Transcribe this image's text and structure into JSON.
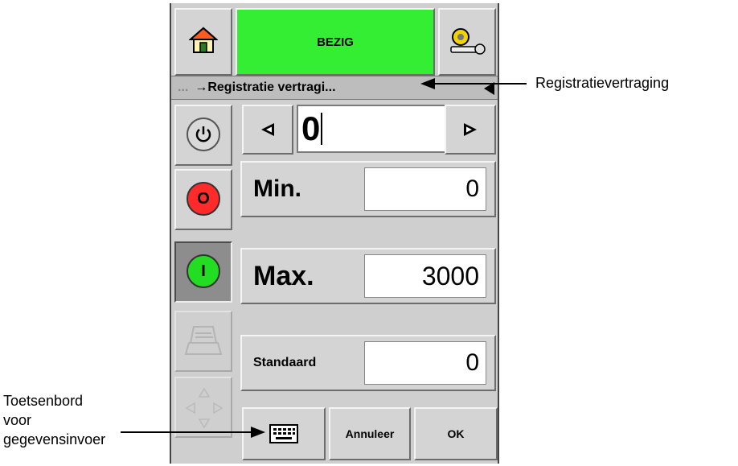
{
  "header": {
    "status_label": "BEZIG",
    "status_color": "#33ee33",
    "home_icon": "home-icon",
    "service_icon": "service-wrench-icon"
  },
  "breadcrumb": {
    "ellipsis": "...",
    "text": "→Registratie vertragi..."
  },
  "sidebar": {
    "items": [
      {
        "icon": "power-icon",
        "label": ""
      },
      {
        "icon": "stop-icon",
        "label": "O",
        "color": "#ff2a2a"
      },
      {
        "icon": "start-icon",
        "label": "I",
        "color": "#22dd22"
      },
      {
        "icon": "printer-icon",
        "label": ""
      },
      {
        "icon": "navigation-arrows-icon",
        "label": ""
      }
    ]
  },
  "editor": {
    "current_value": "0",
    "fields": [
      {
        "label": "Min.",
        "value": "0"
      },
      {
        "label": "Max.",
        "value": "3000"
      },
      {
        "label": "Standaard",
        "value": "0"
      }
    ]
  },
  "footer": {
    "keyboard_icon": "keyboard-icon",
    "cancel_label": "Annuleer",
    "ok_label": "OK"
  },
  "annotations": {
    "registration_delay": "Registratievertraging",
    "keyboard_line1": "Toetsenbord",
    "keyboard_line2": "voor",
    "keyboard_line3": "gegevensinvoer"
  }
}
